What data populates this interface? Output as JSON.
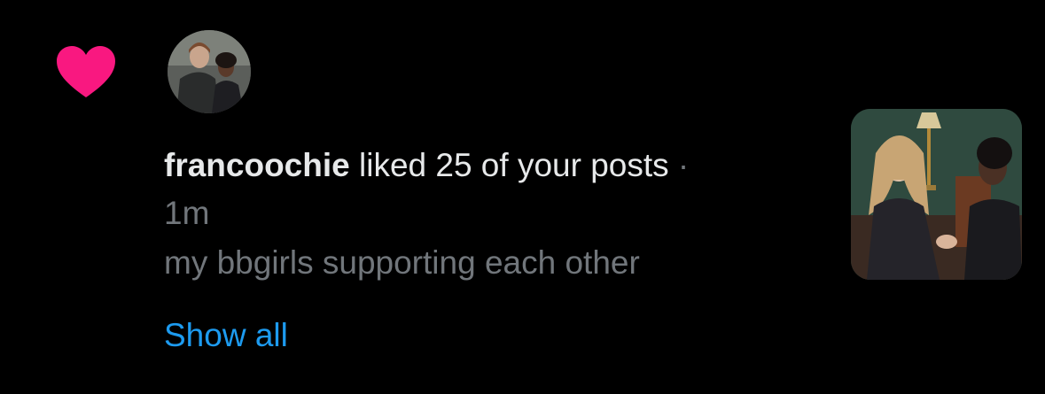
{
  "notification": {
    "icon": "heart-icon",
    "icon_color": "#f91880",
    "username": "francoochie",
    "action": " liked 25 of your posts",
    "separator": " ·",
    "time": "1m",
    "post_text": "my bbgirls supporting each other",
    "show_all": "Show all"
  },
  "colors": {
    "background": "#000000",
    "primary_text": "#e7e9ea",
    "secondary_text": "#71767b",
    "link": "#1d9bf0"
  }
}
